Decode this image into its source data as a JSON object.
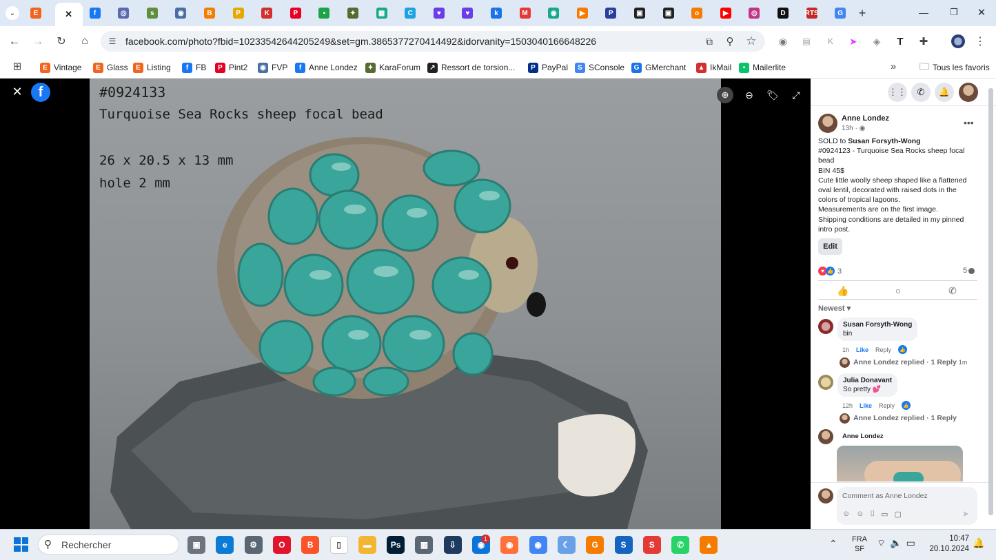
{
  "browser": {
    "tabs": [
      {
        "icon": "etsy-icon",
        "color": "#f1641e",
        "glyph": "E"
      },
      {
        "icon": "close-tab-icon",
        "color": "#ffffff",
        "glyph": "✕",
        "active": true
      },
      {
        "icon": "facebook-icon",
        "color": "#1877f2",
        "glyph": "f"
      },
      {
        "icon": "site-icon",
        "color": "#5b6ab0",
        "glyph": "◎"
      },
      {
        "icon": "shopify-icon",
        "color": "#5e8e3e",
        "glyph": "s"
      },
      {
        "icon": "site-icon",
        "color": "#4a6fa5",
        "glyph": "◉"
      },
      {
        "icon": "blogger-icon",
        "color": "#f57d00",
        "glyph": "B"
      },
      {
        "icon": "site-icon",
        "color": "#e7a700",
        "glyph": "P"
      },
      {
        "icon": "site-icon",
        "color": "#d32f2f",
        "glyph": "K"
      },
      {
        "icon": "pinterest-icon",
        "color": "#e60023",
        "glyph": "P"
      },
      {
        "icon": "chat-icon",
        "color": "#1ea446",
        "glyph": "▪"
      },
      {
        "icon": "site-icon",
        "color": "#556b2f",
        "glyph": "✦"
      },
      {
        "icon": "site-icon",
        "color": "#1aa88a",
        "glyph": "▦"
      },
      {
        "icon": "site-icon",
        "color": "#1fa3e0",
        "glyph": "C"
      },
      {
        "icon": "pocket-icon",
        "color": "#6a3de8",
        "glyph": "♥"
      },
      {
        "icon": "pocket-icon",
        "color": "#6a3de8",
        "glyph": "♥"
      },
      {
        "icon": "site-icon",
        "color": "#1a73e8",
        "glyph": "k"
      },
      {
        "icon": "site-icon",
        "color": "#e53935",
        "glyph": "M"
      },
      {
        "icon": "site-icon",
        "color": "#1aa88a",
        "glyph": "◉"
      },
      {
        "icon": "play-icon",
        "color": "#f57c00",
        "glyph": "▶"
      },
      {
        "icon": "site-icon",
        "color": "#2a3f9d",
        "glyph": "P"
      },
      {
        "icon": "site-icon",
        "color": "#222222",
        "glyph": "▣"
      },
      {
        "icon": "site-icon",
        "color": "#222222",
        "glyph": "▣"
      },
      {
        "icon": "site-icon",
        "color": "#f57c00",
        "glyph": "o"
      },
      {
        "icon": "youtube-icon",
        "color": "#ff0000",
        "glyph": "▶"
      },
      {
        "icon": "instagram-icon",
        "color": "#c13584",
        "glyph": "◎"
      },
      {
        "icon": "site-icon",
        "color": "#111111",
        "glyph": "D"
      },
      {
        "icon": "site-icon",
        "color": "#c62828",
        "glyph": "RTS"
      },
      {
        "icon": "google-icon",
        "color": "#4285f4",
        "glyph": "G"
      }
    ],
    "new_tab": "+",
    "url": "facebook.com/photo?fbid=10233542644205249&set=gm.3865377270414492&idorvanity=1503040166648226",
    "bookmarks": [
      {
        "label": "Vintage",
        "icon": "etsy-icon",
        "color": "#f1641e",
        "glyph": "E"
      },
      {
        "label": "Glass",
        "icon": "etsy-icon",
        "color": "#f1641e",
        "glyph": "E"
      },
      {
        "label": "Listing",
        "icon": "etsy-icon",
        "color": "#f1641e",
        "glyph": "E"
      },
      {
        "label": "FB",
        "icon": "facebook-icon",
        "color": "#1877f2",
        "glyph": "f"
      },
      {
        "label": "Pint2",
        "icon": "pinterest-icon",
        "color": "#e60023",
        "glyph": "P"
      },
      {
        "label": "FVP",
        "icon": "site-icon",
        "color": "#4a6fa5",
        "glyph": "◉"
      },
      {
        "label": "Anne Londez",
        "icon": "facebook-icon",
        "color": "#1877f2",
        "glyph": "f"
      },
      {
        "label": "KaraForum",
        "icon": "site-icon",
        "color": "#556b2f",
        "glyph": "✦"
      },
      {
        "label": "Ressort de torsion...",
        "icon": "site-icon",
        "color": "#222222",
        "glyph": "↗"
      },
      {
        "label": "PayPal",
        "icon": "paypal-icon",
        "color": "#003087",
        "glyph": "P"
      },
      {
        "label": "SConsole",
        "icon": "site-icon",
        "color": "#4285f4",
        "glyph": "S"
      },
      {
        "label": "GMerchant",
        "icon": "site-icon",
        "color": "#1a73e8",
        "glyph": "G"
      },
      {
        "label": "IkMail",
        "icon": "site-icon",
        "color": "#d32f2f",
        "glyph": "▲"
      },
      {
        "label": "Mailerlite",
        "icon": "site-icon",
        "color": "#09c269",
        "glyph": "▪"
      }
    ],
    "more_bookmarks": "»",
    "all_favorites": "Tous les favoris"
  },
  "photo": {
    "line1": "#0924133",
    "line2": "Turquoise Sea Rocks sheep focal bead",
    "line3": "26 x 20.5 x 13 mm",
    "line4": "hole 2 mm"
  },
  "post": {
    "author": "Anne Londez",
    "time": "13h ·",
    "sold_prefix": "SOLD to ",
    "sold_to": "Susan Forsyth-Wong",
    "body": [
      "#0924123 - Turquoise Sea Rocks sheep focal",
      "bead",
      "BIN 45$",
      "Cute little woolly sheep shaped like a flattened",
      "oval lentil, decorated with raised dots in the",
      "colors of tropical lagoons.",
      "Measurements are on the first image.",
      "Shipping conditions are detailed in my pinned",
      "intro post."
    ],
    "edit": "Edit",
    "reactions_count": "3",
    "comments_count": "5",
    "sort": "Newest",
    "comments": [
      {
        "author": "Susan Forsyth-Wong",
        "text": "bin",
        "time": "1h",
        "like": "Like",
        "reply": "Reply",
        "replied": "Anne Londez replied · 1 Reply",
        "replied_time": "1m"
      },
      {
        "author": "Julia Donavant",
        "text": "So pretty 💕",
        "time": "12h",
        "like": "Like",
        "reply": "Reply",
        "replied": "Anne Londez replied · 1 Reply",
        "replied_time": ""
      },
      {
        "author": "Anne Londez",
        "text": "",
        "time": "",
        "like": "",
        "reply": "",
        "replied": "",
        "replied_time": ""
      }
    ],
    "comment_placeholder": "Comment as Anne Londez"
  },
  "taskbar": {
    "search_placeholder": "Rechercher",
    "lang1": "FRA",
    "lang2": "SF",
    "time": "10:47",
    "date": "20.10.2024",
    "badge": "1"
  }
}
